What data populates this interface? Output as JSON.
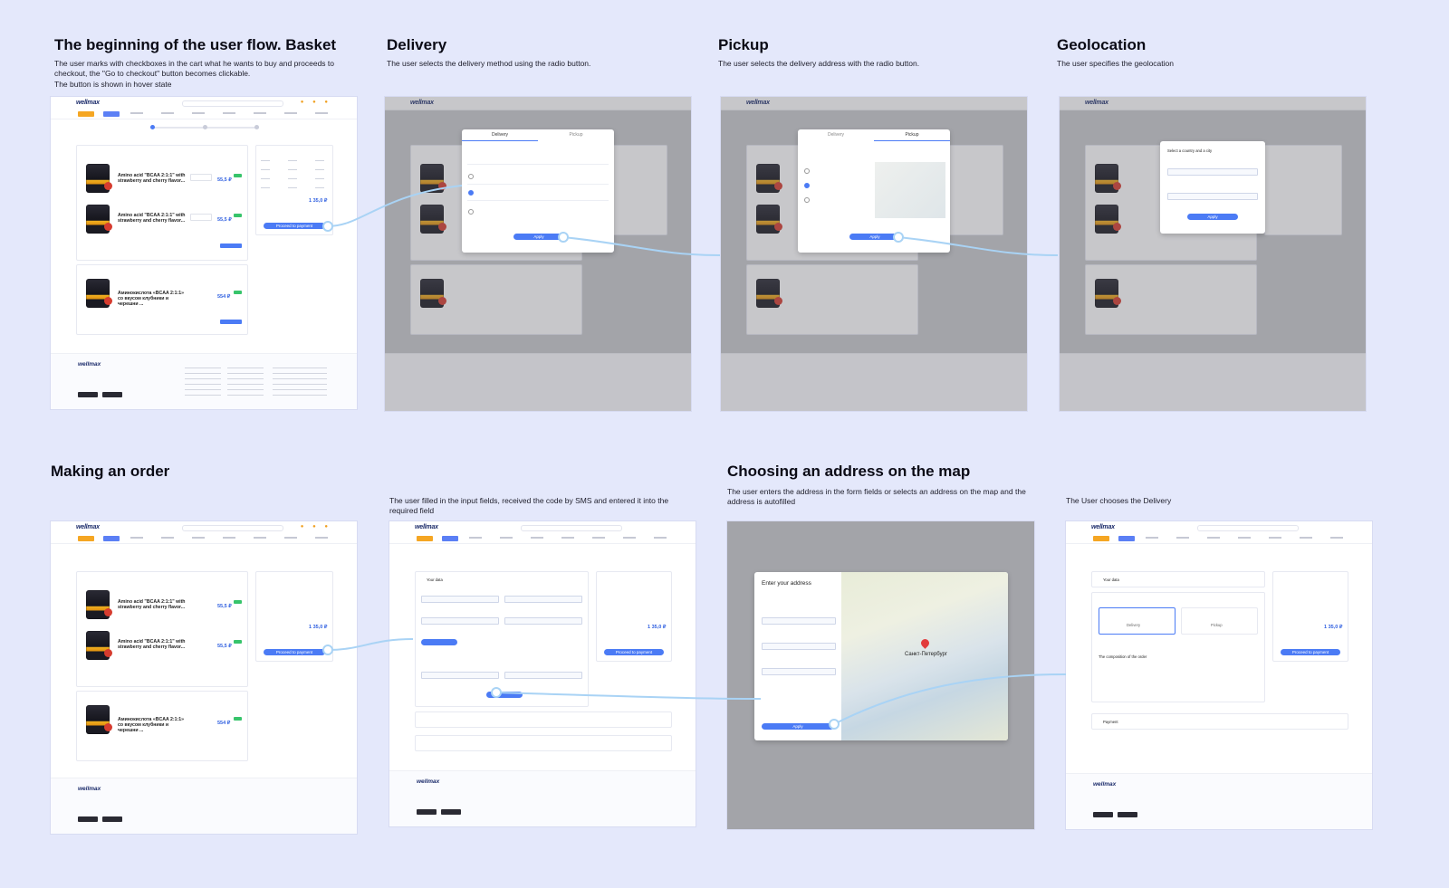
{
  "sections": {
    "basket": {
      "title": "The beginning of the user flow. Basket",
      "desc": "The user marks with checkboxes in the cart what he wants to buy and proceeds to checkout, the \"Go to checkout\" button becomes clickable.",
      "note": "The button is shown in hover state"
    },
    "delivery": {
      "title": "Delivery",
      "desc": "The user selects the delivery method using the radio button."
    },
    "pickup": {
      "title": "Pickup",
      "desc": "The user selects the delivery address with the radio button."
    },
    "geolocation": {
      "title": "Geolocation",
      "desc": "The user specifies the geolocation"
    },
    "order": {
      "title": "Making an order"
    },
    "filled": {
      "desc": "The user filled in the input fields, received the code by SMS and entered it into the required field"
    },
    "map": {
      "title": "Choosing an address on the map",
      "desc": "The user enters the address in the form fields or selects an address on the map and the address is autofilled"
    },
    "choose_delivery": {
      "desc": "The User chooses the Delivery"
    }
  },
  "mock": {
    "logo": "wellmax",
    "product_1": "Amino acid \"BCAA 2:1:1\" with strawberry and cherry flavor...",
    "product_2": "Amino acid \"BCAA 2:1:1\" with strawberry and cherry flavor...",
    "product_3": "Аминокислота «BCAA 2:1:1» со вкусом клубники и черешни ...",
    "price_1": "55,5 ₽",
    "price_2": "55,5 ₽",
    "price_3": "554 ₽",
    "summary_total": "1 35,0 ₽",
    "go_to_checkout": "Proceed to payment",
    "delivery_tab": "Delivery",
    "pickup_tab": "Pickup",
    "apply": "Apply",
    "select_city": "Select a country and a city",
    "enter_address": "Enter your address",
    "map_city": "Санкт-Петербург",
    "composition": "The composition of the order",
    "your_data": "Your data",
    "payment": "Payment",
    "delivery_choice": "Delivery",
    "pickup_choice": "Pickup"
  }
}
